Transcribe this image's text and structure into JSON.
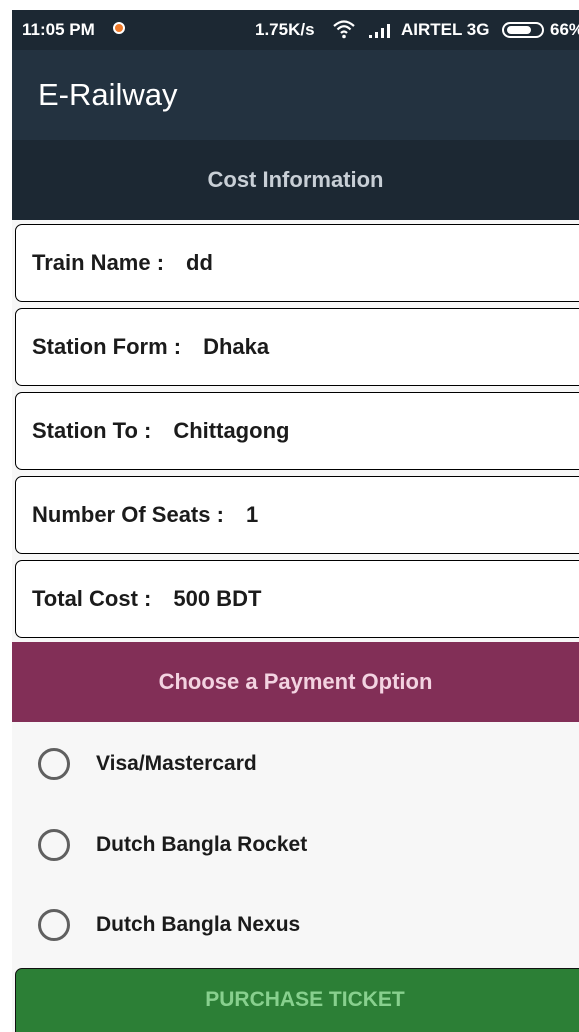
{
  "status_bar": {
    "time": "11:05 PM",
    "network_speed": "1.75K/s",
    "carrier": "AIRTEL 3G",
    "battery": "66%",
    "notification_icon": "notification-dot-icon",
    "wifi_icon": "wifi-icon",
    "signal_icon": "signal-icon",
    "battery_icon": "battery-icon"
  },
  "app_bar": {
    "title": "E-Railway"
  },
  "cost_section": {
    "header": "Cost Information",
    "fields": [
      {
        "label": "Train Name :",
        "value": "dd"
      },
      {
        "label": "Station Form :",
        "value": "Dhaka"
      },
      {
        "label": "Station To :",
        "value": "Chittagong"
      },
      {
        "label": "Number Of Seats :",
        "value": "1"
      },
      {
        "label": "Total Cost :",
        "value": "500 BDT"
      }
    ]
  },
  "payment_section": {
    "header": "Choose a Payment Option",
    "options": [
      {
        "label": "Visa/Mastercard",
        "selected": false
      },
      {
        "label": "Dutch Bangla Rocket",
        "selected": false
      },
      {
        "label": "Dutch Bangla Nexus",
        "selected": false
      }
    ]
  },
  "purchase_button": {
    "label": "PURCHASE TICKET"
  },
  "colors": {
    "app_bar": "#233240",
    "section_header": "#1c2833",
    "payment_header": "#822f57",
    "purchase_button": "#2c7f36"
  }
}
